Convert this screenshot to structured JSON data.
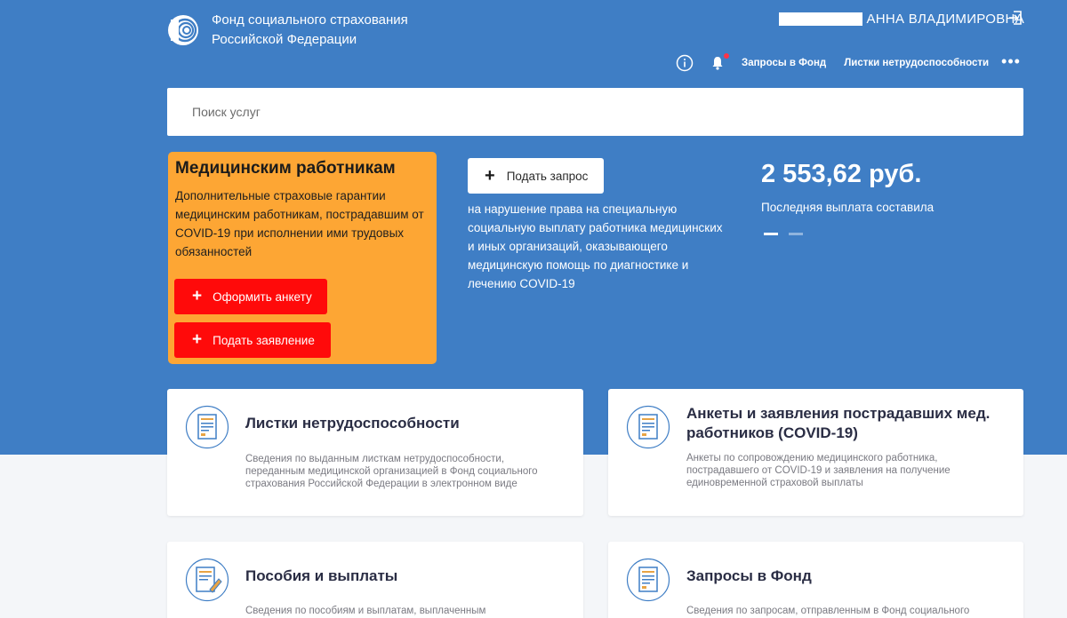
{
  "header": {
    "org_line1": "Фонд социального страхования",
    "org_line2": "Российской Федерации",
    "user_name": "АННА ВЛАДИМИРОВНА"
  },
  "nav": {
    "requests": "Запросы в Фонд",
    "sick_leaves": "Листки нетрудоспособности",
    "more": "•••"
  },
  "search": {
    "placeholder": "Поиск услуг"
  },
  "promo": {
    "title": "Медицинским работникам",
    "text": "Дополнительные страховые гарантии медицинским работникам, пострадавшим от COVID-19 при исполнении ими трудовых обязанностей",
    "btn_form": "Оформить анкету",
    "btn_apply": "Подать заявление"
  },
  "request": {
    "btn": "Подать запрос",
    "text": "на нарушение права на специальную социальную выплату работника медицинских и иных организаций, оказывающего медицинскую помощь по диагностике и лечению COVID-19"
  },
  "payment": {
    "amount": "2 553,62 руб.",
    "label": "Последняя выплата составила"
  },
  "cards": [
    {
      "title": "Листки нетрудоспособности",
      "desc": "Сведения по выданным листкам нетрудоспособности, переданным медицинской организацией в Фонд социального страхования Российской Федерации в электронном виде"
    },
    {
      "title": "Анкеты и заявления пострадавших мед. работников (COVID-19)",
      "desc": "Анкеты по сопровождению медицинского работника, пострадавшего от COVID-19 и заявления на получение единовременной страховой выплаты"
    },
    {
      "title": "Пособия и выплаты",
      "desc": "Сведения по пособиям и выплатам, выплаченным"
    },
    {
      "title": "Запросы в Фонд",
      "desc": "Сведения по запросам, отправленным в Фонд социального"
    }
  ],
  "colors": {
    "hero": "#3f7ec5",
    "promo": "#fda634",
    "button_red": "#ff0a0a",
    "notification": "#ff3347"
  }
}
